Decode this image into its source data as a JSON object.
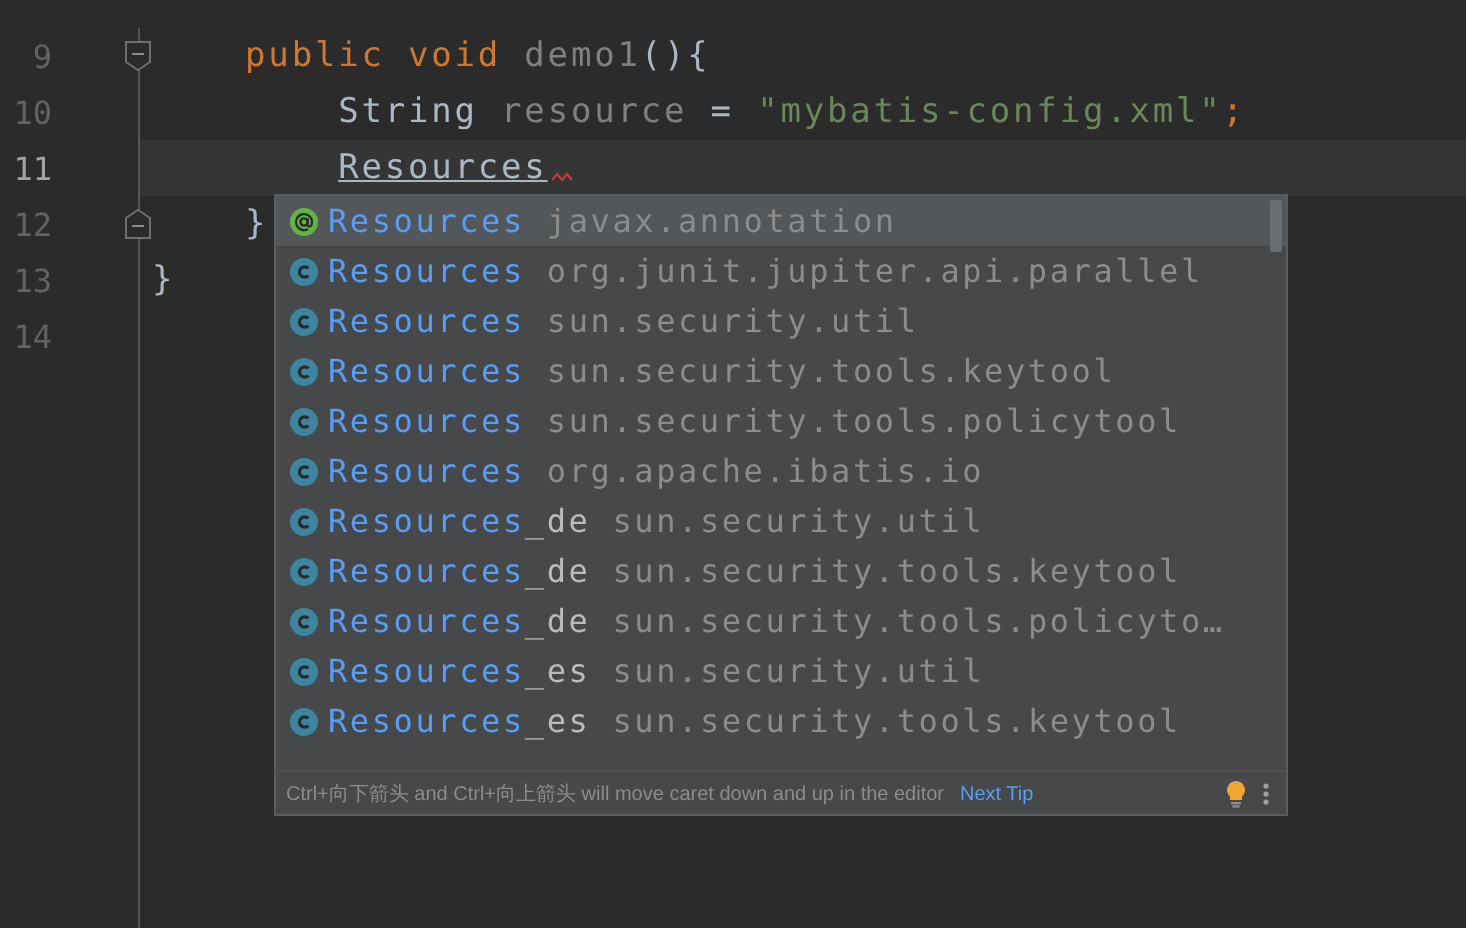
{
  "editor": {
    "lines": [
      {
        "number": "9",
        "current": false,
        "fold_start": true,
        "tokens": [
          {
            "kind": "keyword",
            "text": "    public void "
          },
          {
            "kind": "unused",
            "text": "demo1"
          },
          {
            "kind": "plain",
            "text": "(){"
          }
        ]
      },
      {
        "number": "10",
        "current": false,
        "tokens": [
          {
            "kind": "plain",
            "text": "        String "
          },
          {
            "kind": "unused",
            "text": "resource"
          },
          {
            "kind": "plain",
            "text": " = "
          },
          {
            "kind": "string",
            "text": "\"mybatis-config.xml\""
          },
          {
            "kind": "keyword",
            "text": ";"
          }
        ]
      },
      {
        "number": "11",
        "current": true,
        "tokens": [
          {
            "kind": "typed",
            "text": "        Resources",
            "error": true
          }
        ]
      },
      {
        "number": "12",
        "current": false,
        "fold_end": true,
        "tokens": [
          {
            "kind": "plain",
            "text": "    }"
          }
        ]
      },
      {
        "number": "13",
        "current": false,
        "tokens": [
          {
            "kind": "plain",
            "text": "}"
          }
        ]
      },
      {
        "number": "14",
        "current": false
      }
    ]
  },
  "completion": {
    "items": [
      {
        "kind": "annotation",
        "match": "Resources",
        "package": "javax.annotation",
        "selected": true
      },
      {
        "kind": "class",
        "match": "Resources",
        "package": "org.junit.jupiter.api.parallel",
        "selected": false
      },
      {
        "kind": "class",
        "match": "Resources",
        "package": "sun.security.util",
        "selected": false
      },
      {
        "kind": "class",
        "match": "Resources",
        "package": "sun.security.tools.keytool",
        "selected": false
      },
      {
        "kind": "class",
        "match": "Resources",
        "package": "sun.security.tools.policytool",
        "selected": false
      },
      {
        "kind": "class",
        "match": "Resources",
        "package": "org.apache.ibatis.io",
        "selected": false
      },
      {
        "kind": "class",
        "match": "Resources",
        "rest": "_de",
        "package": "sun.security.util",
        "selected": false
      },
      {
        "kind": "class",
        "match": "Resources",
        "rest": "_de",
        "package": "sun.security.tools.keytool",
        "selected": false
      },
      {
        "kind": "class",
        "match": "Resources",
        "rest": "_de",
        "package": "sun.security.tools.policyto…",
        "selected": false
      },
      {
        "kind": "class",
        "match": "Resources",
        "rest": "_es",
        "package": "sun.security.util",
        "selected": false
      },
      {
        "kind": "class",
        "match": "Resources",
        "rest": "_es",
        "package": "sun.security.tools.keytool",
        "selected": false
      }
    ],
    "footer": {
      "tip": "Ctrl+向下箭头 and Ctrl+向上箭头 will move caret down and up in the editor",
      "link": "Next Tip"
    }
  }
}
